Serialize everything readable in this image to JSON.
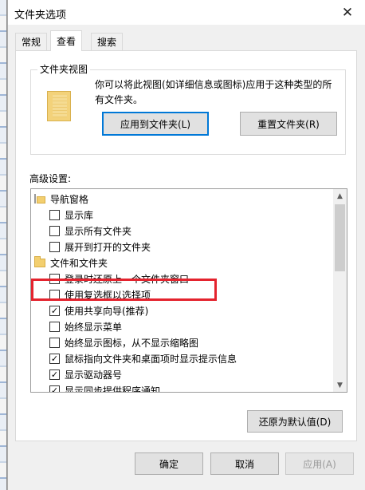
{
  "window": {
    "title": "文件夹选项"
  },
  "tabs": [
    {
      "label": "常规"
    },
    {
      "label": "查看"
    },
    {
      "label": "搜索"
    }
  ],
  "folder_views": {
    "title": "文件夹视图",
    "description": "你可以将此视图(如详细信息或图标)应用于这种类型的所有文件夹。",
    "apply_button": "应用到文件夹(L)",
    "reset_button": "重置文件夹(R)"
  },
  "advanced": {
    "label": "高级设置:",
    "items": [
      {
        "type": "category",
        "icon": "navigation-pane-icon",
        "label": "导航窗格"
      },
      {
        "type": "checkbox",
        "checked": false,
        "label": "显示库"
      },
      {
        "type": "checkbox",
        "checked": false,
        "label": "显示所有文件夹"
      },
      {
        "type": "checkbox",
        "checked": false,
        "label": "展开到打开的文件夹"
      },
      {
        "type": "category",
        "icon": "folder-icon",
        "label": "文件和文件夹"
      },
      {
        "type": "checkbox",
        "checked": false,
        "label": "登录时还原上一个文件夹窗口"
      },
      {
        "type": "checkbox",
        "checked": false,
        "label": "使用复选框以选择项"
      },
      {
        "type": "checkbox",
        "checked": true,
        "label": "使用共享向导(推荐)"
      },
      {
        "type": "checkbox",
        "checked": false,
        "label": "始终显示菜单"
      },
      {
        "type": "checkbox",
        "checked": false,
        "label": "始终显示图标，从不显示缩略图"
      },
      {
        "type": "checkbox",
        "checked": true,
        "label": "鼠标指向文件夹和桌面项时显示提示信息"
      },
      {
        "type": "checkbox",
        "checked": true,
        "label": "显示驱动器号"
      },
      {
        "type": "checkbox",
        "checked": true,
        "label": "显示同步提供程序通知"
      }
    ]
  },
  "restore_defaults_button": "还原为默认值(D)",
  "footer": {
    "ok": "确定",
    "cancel": "取消",
    "apply": "应用(A)"
  },
  "colors": {
    "highlight": "#e4232e",
    "focus_blue": "#0078d7"
  }
}
